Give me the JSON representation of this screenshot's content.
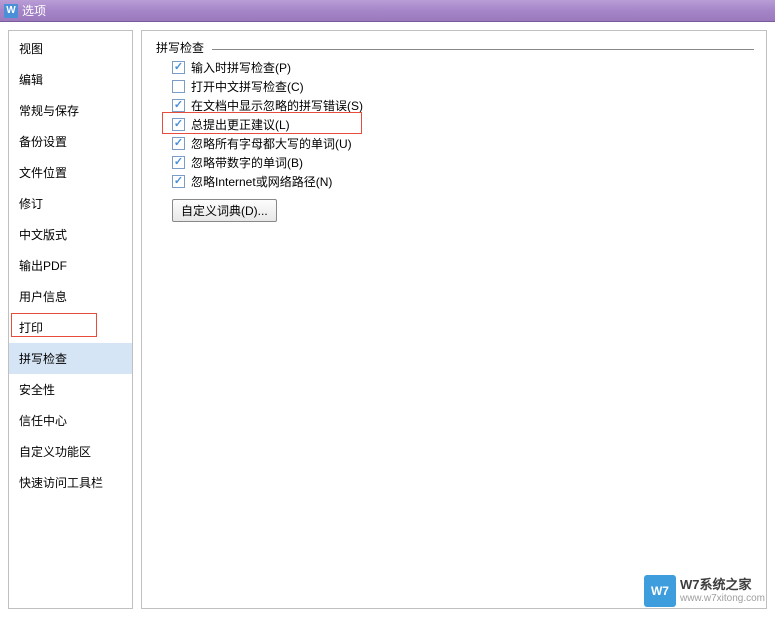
{
  "window": {
    "icon_letter": "W",
    "title": "选项"
  },
  "sidebar": {
    "items": [
      {
        "label": "视图"
      },
      {
        "label": "编辑"
      },
      {
        "label": "常规与保存"
      },
      {
        "label": "备份设置"
      },
      {
        "label": "文件位置"
      },
      {
        "label": "修订"
      },
      {
        "label": "中文版式"
      },
      {
        "label": "输出PDF"
      },
      {
        "label": "用户信息"
      },
      {
        "label": "打印"
      },
      {
        "label": "拼写检查",
        "selected": true
      },
      {
        "label": "安全性"
      },
      {
        "label": "信任中心"
      },
      {
        "label": "自定义功能区"
      },
      {
        "label": "快速访问工具栏"
      }
    ]
  },
  "main": {
    "group_label": "拼写检查",
    "checkboxes": [
      {
        "label": "输入时拼写检查(P)",
        "checked": true
      },
      {
        "label": "打开中文拼写检查(C)",
        "checked": false
      },
      {
        "label": "在文档中显示忽略的拼写错误(S)",
        "checked": true
      },
      {
        "label": "总提出更正建议(L)",
        "checked": true,
        "highlighted": true
      },
      {
        "label": "忽略所有字母都大写的单词(U)",
        "checked": true
      },
      {
        "label": "忽略带数字的单词(B)",
        "checked": true
      },
      {
        "label": "忽略Internet或网络路径(N)",
        "checked": true
      }
    ],
    "custom_dict_button": "自定义词典(D)..."
  },
  "watermark": {
    "icon": "W7",
    "line1": "W7系统之家",
    "line2": "www.w7xitong.com"
  }
}
